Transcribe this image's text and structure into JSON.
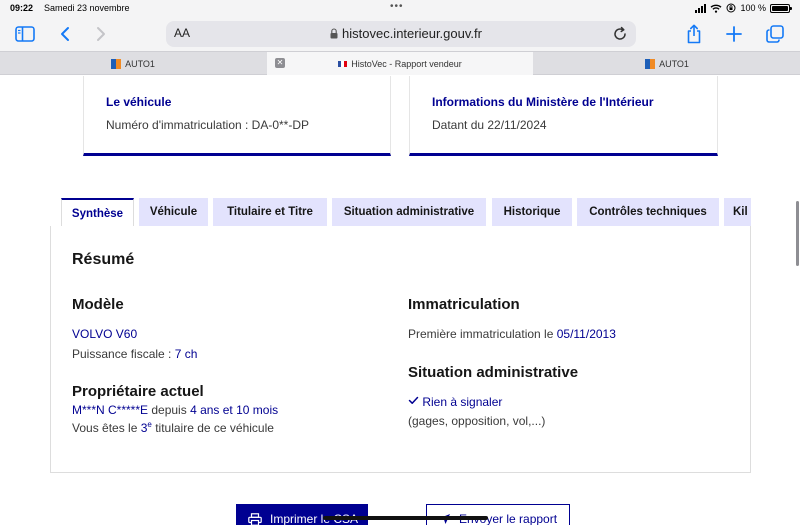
{
  "status": {
    "time": "09:22",
    "date": "Samedi 23 novembre",
    "battery": "100 %",
    "battery_level": 1.0
  },
  "browser": {
    "text_size_label": "AA",
    "url": "histovec.interieur.gouv.fr",
    "icons": [
      "sidebar-icon",
      "back-icon",
      "forward-icon",
      "share-icon",
      "new-tab-icon",
      "tabs-overview-icon",
      "reload-icon",
      "lock-icon"
    ],
    "tabs": [
      {
        "label": "AUTO1",
        "favicon": "auto1-favicon"
      },
      {
        "label": "HistoVec - Rapport vendeur",
        "favicon": "french-flag-icon",
        "active": true
      },
      {
        "label": "AUTO1",
        "favicon": "auto1-favicon"
      }
    ]
  },
  "cards": [
    {
      "title": "Le véhicule",
      "value": "Numéro d'immatriculation : DA-0**-DP"
    },
    {
      "title": "Informations du Ministère de l'Intérieur",
      "value": "Datant du 22/11/2024"
    }
  ],
  "page_tabs": [
    "Synthèse",
    "Véhicule",
    "Titulaire et Titre",
    "Situation administrative",
    "Historique",
    "Contrôles techniques",
    "Kil"
  ],
  "active_tab": "Synthèse",
  "summary": {
    "heading": "Résumé",
    "model": {
      "heading": "Modèle",
      "name": "VOLVO V60",
      "power_label": "Puissance fiscale : ",
      "power_value": "7 ch"
    },
    "owner": {
      "heading": "Propriétaire actuel",
      "name": "M***N C*****E",
      "since_label": " depuis ",
      "since_value": "4 ans et 10 mois",
      "rank_prefix": "Vous êtes le ",
      "rank_number": "3",
      "rank_suffix": "e",
      "rank_rest": " titulaire de ce véhicule"
    },
    "registration": {
      "heading": "Immatriculation",
      "first_label": "Première immatriculation le ",
      "first_date": "05/11/2013"
    },
    "admin": {
      "heading": "Situation administrative",
      "status": "Rien à signaler",
      "detail": "(gages, opposition, vol,...)"
    }
  },
  "actions": {
    "print_label": "Imprimer le CSA",
    "send_label": "Envoyer le rapport"
  },
  "colors": {
    "brand_blue": "#000091",
    "tab_bg": "#e3e3fd",
    "safari_blue": "#1479f6"
  }
}
